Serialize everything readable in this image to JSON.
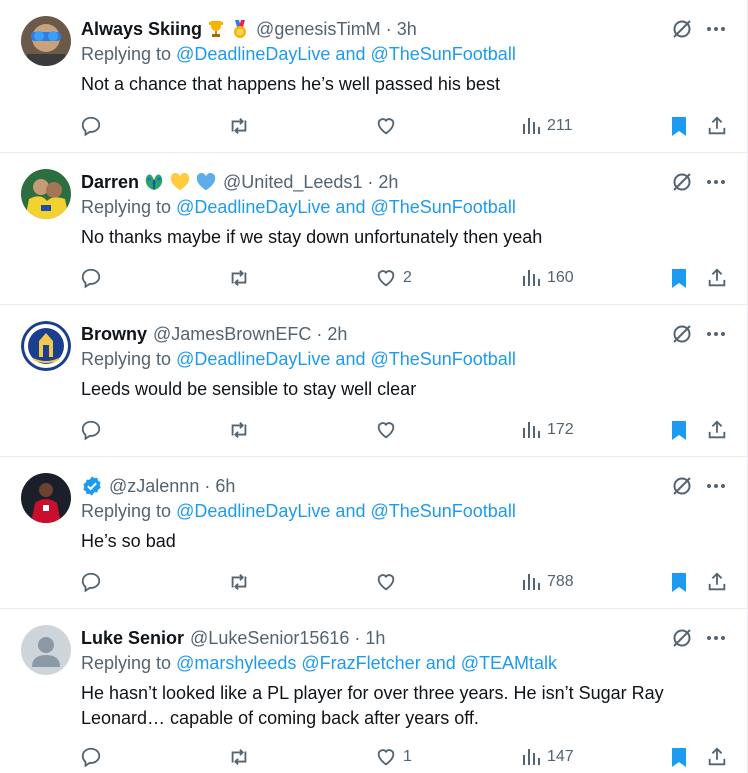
{
  "colors": {
    "link": "#1d9bf0",
    "muted": "#536471",
    "text": "#0f1419",
    "bookmark": "#1d9bf0"
  },
  "tweets": [
    {
      "name": "Always Skiing",
      "badges": [
        "trophy-emoji",
        "medal-emoji"
      ],
      "handle": "@genesisTimM",
      "dot": "·",
      "time": "3h",
      "replying_label": "Replying to",
      "replying_to": "@DeadlineDayLive and @TheSunFootball",
      "text": "Not a chance that happens he’s well passed his best",
      "likes": "",
      "views": "211"
    },
    {
      "name": "Darren",
      "badges": [
        "peacock-emoji",
        "yellow-heart-emoji",
        "blue-heart-emoji"
      ],
      "handle": "@United_Leeds1",
      "dot": "·",
      "time": "2h",
      "replying_label": "Replying to",
      "replying_to": "@DeadlineDayLive and @TheSunFootball",
      "text": "No thanks maybe if we stay down unfortunately then yeah",
      "likes": "2",
      "views": "160"
    },
    {
      "name": "Browny",
      "badges": [],
      "handle": "@JamesBrownEFC",
      "dot": "·",
      "time": "2h",
      "replying_label": "Replying to",
      "replying_to": "@DeadlineDayLive and @TheSunFootball",
      "text": "Leeds would be sensible to stay well clear",
      "likes": "",
      "views": "172"
    },
    {
      "name": "",
      "badges": [
        "verified-icon"
      ],
      "handle": "@zJalennn",
      "dot": "·",
      "time": "6h",
      "replying_label": "Replying to",
      "replying_to": "@DeadlineDayLive and @TheSunFootball",
      "text": "He’s so bad",
      "likes": "",
      "views": "788"
    },
    {
      "name": "Luke Senior",
      "badges": [],
      "handle": "@LukeSenior15616",
      "dot": "·",
      "time": "1h",
      "replying_label": "Replying to",
      "replying_to": "@marshyleeds @FrazFletcher and @TEAMtalk",
      "text": "He hasn’t looked like a PL player for over three years. He isn’t Sugar Ray Leonard… capable of coming back after years off.",
      "likes": "1",
      "views": "147"
    }
  ]
}
